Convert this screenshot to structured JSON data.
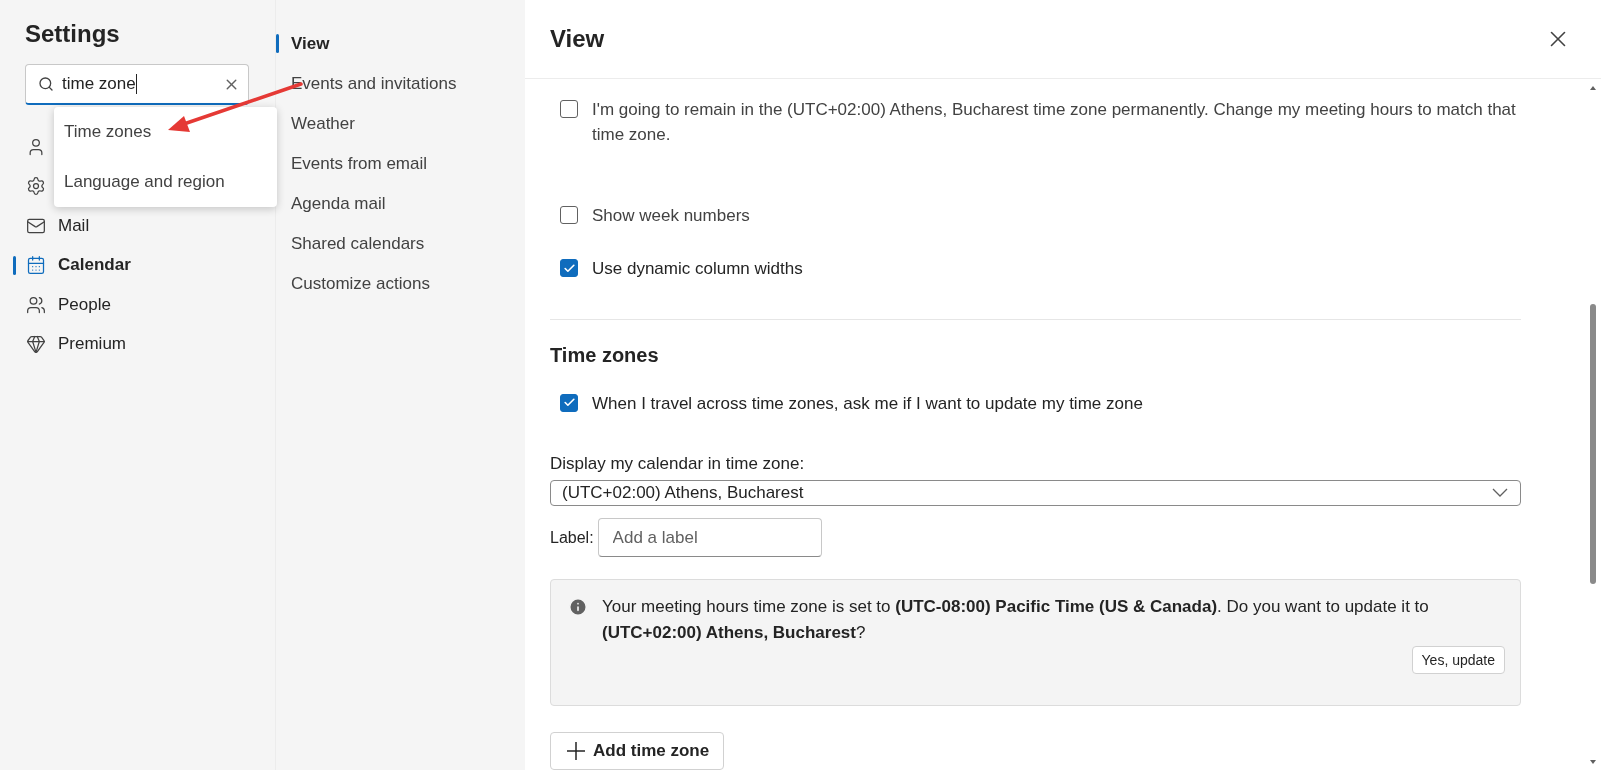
{
  "sidebar": {
    "title": "Settings",
    "search": {
      "value": "time zone"
    },
    "suggestions": [
      {
        "label": "Time zones",
        "selected": false
      },
      {
        "label": "Language and region",
        "selected": false
      }
    ],
    "items": [
      {
        "kind": "person",
        "selected": false
      },
      {
        "kind": "gear",
        "selected": false
      },
      {
        "kind": "mail",
        "label": "Mail",
        "selected": false
      },
      {
        "kind": "calendar",
        "label": "Calendar",
        "selected": true
      },
      {
        "kind": "people",
        "label": "People",
        "selected": false
      },
      {
        "kind": "diamond",
        "label": "Premium",
        "selected": false
      }
    ]
  },
  "subnav": {
    "items": [
      {
        "label": "View",
        "selected": true
      },
      {
        "label": "Events and invitations",
        "selected": false
      },
      {
        "label": "Weather",
        "selected": false
      },
      {
        "label": "Events from email",
        "selected": false
      },
      {
        "label": "Agenda mail",
        "selected": false
      },
      {
        "label": "Shared calendars",
        "selected": false
      },
      {
        "label": "Customize actions",
        "selected": false
      }
    ]
  },
  "panel": {
    "title": "View",
    "options": [
      {
        "label": "I'm going to remain in the (UTC+02:00) Athens, Bucharest time zone permanently. Change my meeting hours to match that time zone.",
        "checked": false
      },
      {
        "label": "Show week numbers",
        "checked": false
      },
      {
        "label": "Use dynamic column widths",
        "checked": true
      }
    ],
    "time_zones": {
      "heading": "Time zones",
      "travel_option": {
        "label": "When I travel across time zones, ask me if I want to update my time zone",
        "checked": true
      },
      "display_label": "Display my calendar in time zone:",
      "display_value": "(UTC+02:00) Athens, Bucharest",
      "label_caption": "Label:",
      "label_placeholder": "Add a label",
      "notice": "Your meeting hours time zone is set to **(UTC-08:00) Pacific Time (US & Canada)**. Do you want to update it to **(UTC+02:00) Athens, Bucharest**?",
      "notice_button": "Yes, update",
      "add_button": "Add time zone"
    }
  }
}
